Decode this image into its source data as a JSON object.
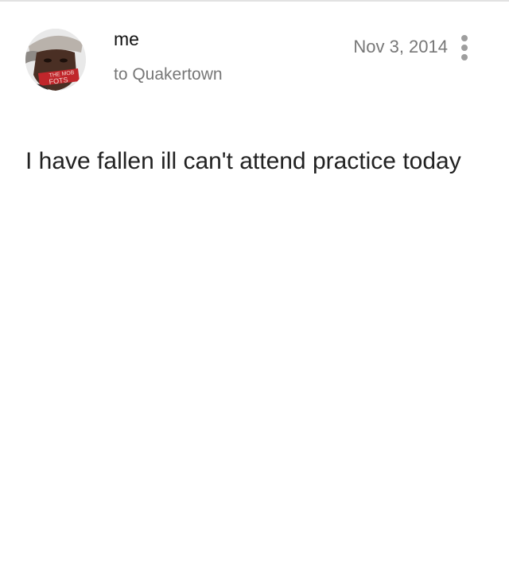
{
  "message": {
    "sender": "me",
    "recipient": "to Quakertown",
    "date": "Nov 3, 2014",
    "body": "I have fallen ill can't attend practice today"
  },
  "icons": {
    "more": "more-vert-icon",
    "avatar": "avatar-photo"
  },
  "avatar_text": "THE MOB FOTS",
  "colors": {
    "sender_text": "#111111",
    "secondary_text": "#777777",
    "body_text": "#222222",
    "menu_dots": "#9e9e9e",
    "avatar_tape": "#c0262b"
  }
}
